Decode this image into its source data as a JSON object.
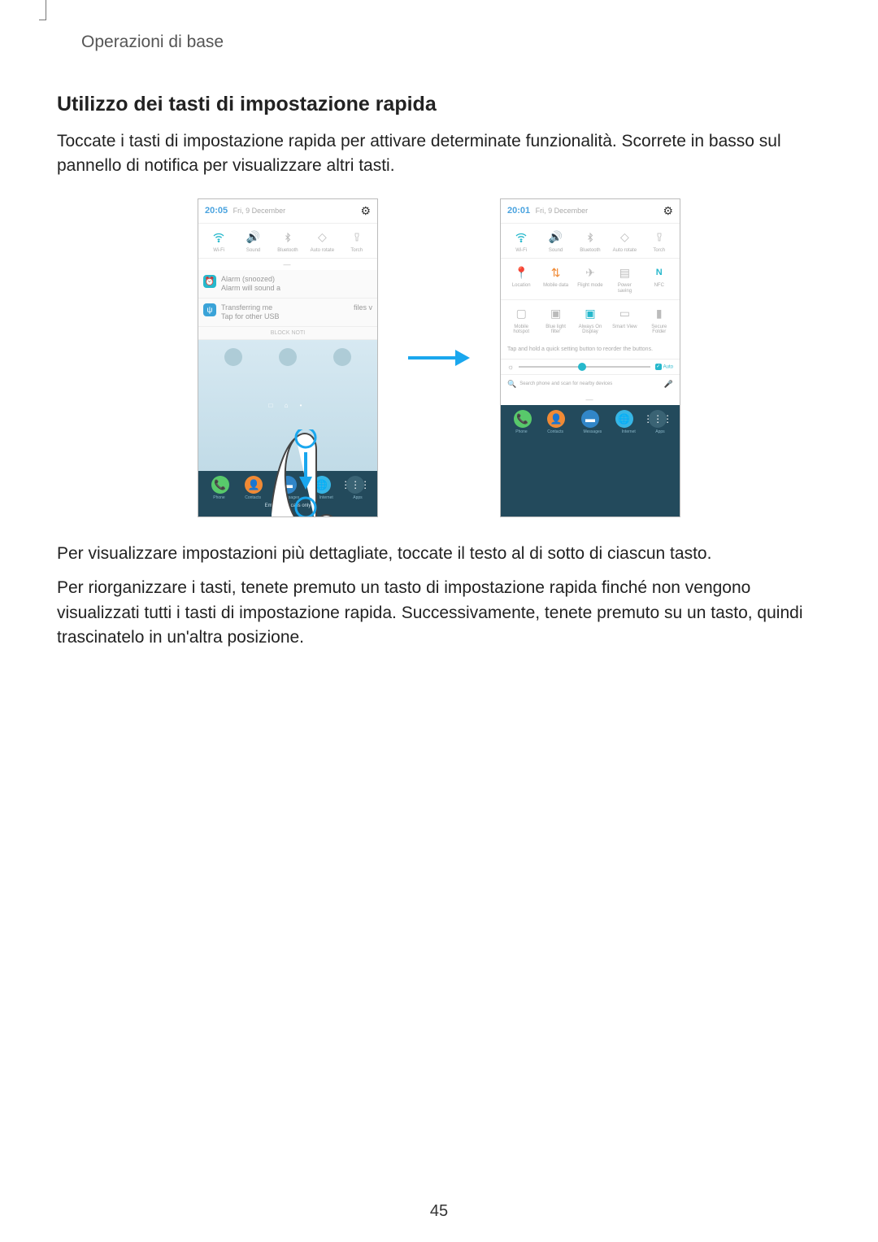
{
  "breadcrumb": "Operazioni di base",
  "heading": "Utilizzo dei tasti di impostazione rapida",
  "para1": "Toccate i tasti di impostazione rapida per attivare determinate funzionalità. Scorrete in basso sul pannello di notifica per visualizzare altri tasti.",
  "para2": "Per visualizzare impostazioni più dettagliate, toccate il testo al di sotto di ciascun tasto.",
  "para3": "Per riorganizzare i tasti, tenete premuto un tasto di impostazione rapida finché non vengono visualizzati tutti i tasti di impostazione rapida. Successivamente, tenete premuto su un tasto, quindi trascinatelo in un'altra posizione.",
  "page_number": "45",
  "phone_left": {
    "time": "20:05",
    "date": "Fri, 9 December",
    "toggles_row1_labels": [
      "Wi-Fi",
      "Sound",
      "Bluetooth",
      "Auto rotate",
      "Torch"
    ],
    "notif1_title": "Alarm (snoozed)",
    "notif1_sub": "Alarm will sound a",
    "notif2_title": "Transferring me",
    "notif2_sub": "Tap for other USB",
    "notif2_right": "files v",
    "block": "BLOCK NOTI",
    "dock_labels": [
      "Phone",
      "Contacts",
      "Messages",
      "Internet",
      "Apps"
    ],
    "emergency": "Emergency calls only"
  },
  "phone_right": {
    "time": "20:01",
    "date": "Fri, 9 December",
    "row1_labels": [
      "Wi-Fi",
      "Sound",
      "Bluetooth",
      "Auto rotate",
      "Torch"
    ],
    "row2_labels": [
      "Location",
      "Mobile data",
      "Flight mode",
      "Power saving",
      "NFC"
    ],
    "row3_labels": [
      "Mobile hotspot",
      "Blue light filter",
      "Always On Display",
      "Smart View",
      "Secure Folder"
    ],
    "hint": "Tap and hold a quick setting button to reorder the buttons.",
    "auto_label": "Auto",
    "search_placeholder": "Search phone and scan for nearby devices",
    "dock_labels": [
      "Phone",
      "Contacts",
      "Messages",
      "Internet",
      "Apps"
    ]
  }
}
